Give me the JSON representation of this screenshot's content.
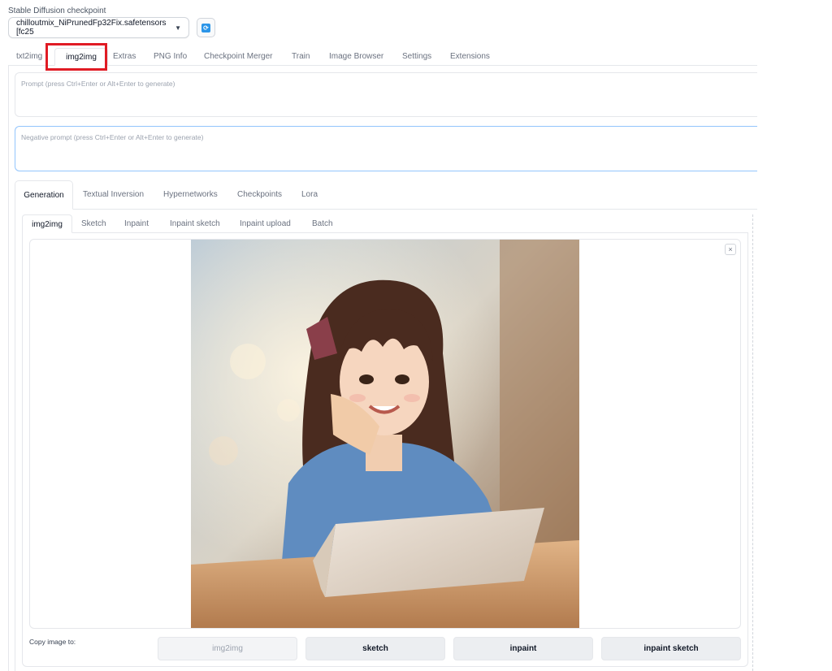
{
  "checkpoint": {
    "label": "Stable Diffusion checkpoint",
    "value": "chilloutmix_NiPrunedFp32Fix.safetensors [fc25",
    "refresh_icon": "refresh-icon"
  },
  "main_tabs": [
    "txt2img",
    "img2img",
    "Extras",
    "PNG Info",
    "Checkpoint Merger",
    "Train",
    "Image Browser",
    "Settings",
    "Extensions"
  ],
  "prompt": {
    "placeholder": "Prompt (press Ctrl+Enter or Alt+Enter to generate)"
  },
  "negative_prompt": {
    "placeholder": "Negative prompt (press Ctrl+Enter or Alt+Enter to generate)"
  },
  "gen_tabs": [
    "Generation",
    "Textual Inversion",
    "Hypernetworks",
    "Checkpoints",
    "Lora"
  ],
  "sub_tabs": [
    "img2img",
    "Sketch",
    "Inpaint",
    "Inpaint sketch",
    "Inpaint upload",
    "Batch"
  ],
  "image": {
    "close_symbol": "×"
  },
  "copy": {
    "label": "Copy image to:",
    "buttons": [
      "img2img",
      "sketch",
      "inpaint",
      "inpaint sketch"
    ]
  },
  "colors": {
    "highlight": "#e01b24",
    "accent": "#2b95e8"
  }
}
